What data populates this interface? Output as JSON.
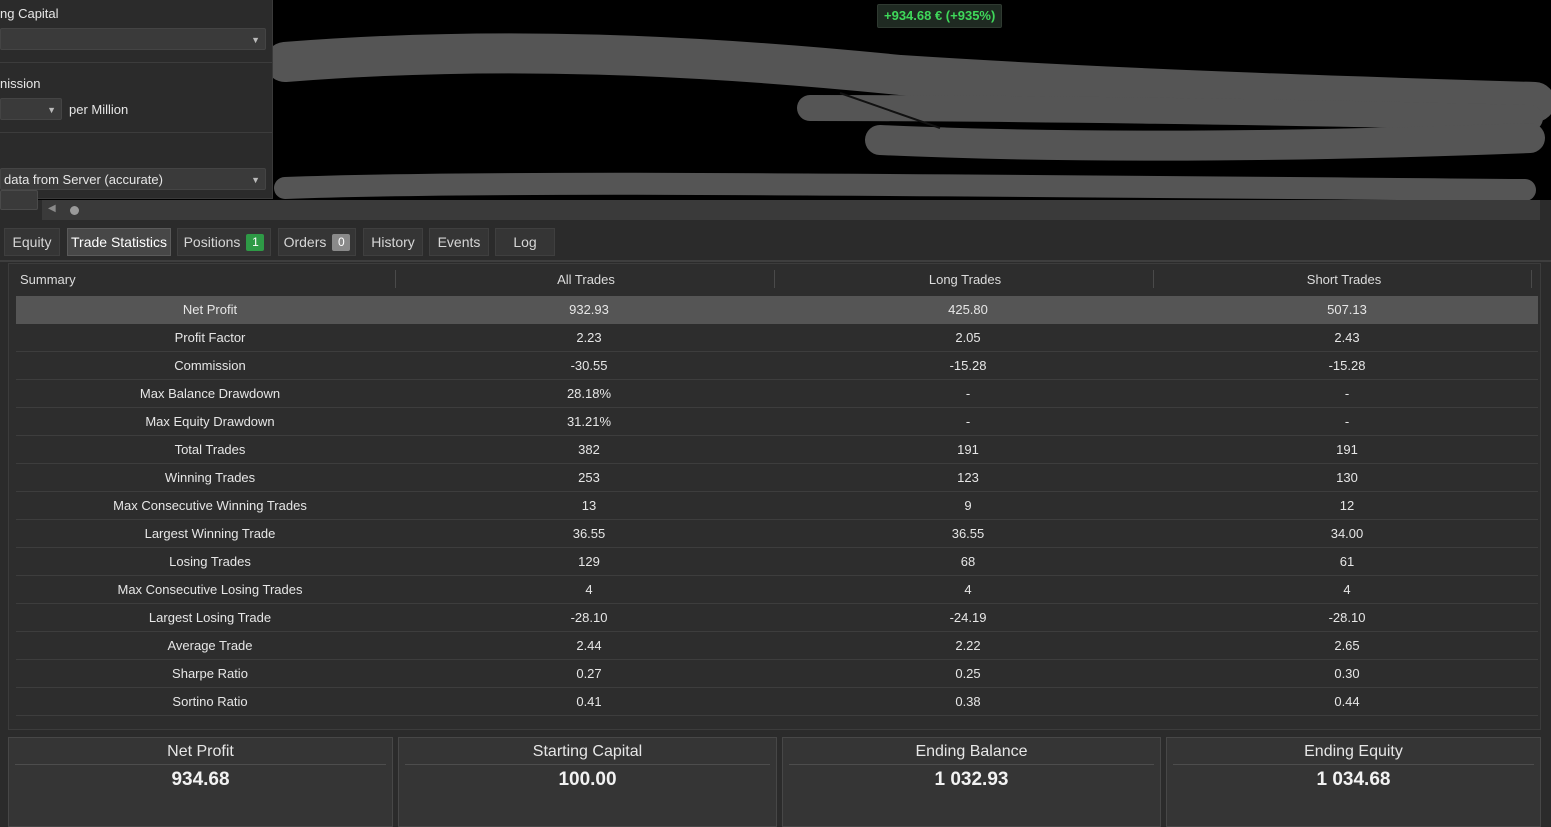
{
  "chart": {
    "profit_badge": "+934.68 € (+935%)"
  },
  "settings": {
    "capital_label": "ng Capital",
    "capital_value": "",
    "commission_label": "nission",
    "commission_value": "",
    "commission_unit": "per Million",
    "data_source_value": "data from Server (accurate)"
  },
  "tabs": [
    {
      "label": "Equity"
    },
    {
      "label": "Trade Statistics"
    },
    {
      "label": "Positions",
      "badge": "1"
    },
    {
      "label": "Orders",
      "badge": "0"
    },
    {
      "label": "History"
    },
    {
      "label": "Events"
    },
    {
      "label": "Log"
    }
  ],
  "stats": {
    "headers": [
      "Summary",
      "All Trades",
      "Long Trades",
      "Short Trades"
    ],
    "rows": [
      [
        "Net Profit",
        "932.93",
        "425.80",
        "507.13"
      ],
      [
        "Profit Factor",
        "2.23",
        "2.05",
        "2.43"
      ],
      [
        "Commission",
        "-30.55",
        "-15.28",
        "-15.28"
      ],
      [
        "Max Balance Drawdown",
        "28.18%",
        "-",
        "-"
      ],
      [
        "Max Equity Drawdown",
        "31.21%",
        "-",
        "-"
      ],
      [
        "Total Trades",
        "382",
        "191",
        "191"
      ],
      [
        "Winning Trades",
        "253",
        "123",
        "130"
      ],
      [
        "Max Consecutive Winning Trades",
        "13",
        "9",
        "12"
      ],
      [
        "Largest Winning Trade",
        "36.55",
        "36.55",
        "34.00"
      ],
      [
        "Losing Trades",
        "129",
        "68",
        "61"
      ],
      [
        "Max Consecutive Losing Trades",
        "4",
        "4",
        "4"
      ],
      [
        "Largest Losing Trade",
        "-28.10",
        "-24.19",
        "-28.10"
      ],
      [
        "Average Trade",
        "2.44",
        "2.22",
        "2.65"
      ],
      [
        "Sharpe Ratio",
        "0.27",
        "0.25",
        "0.30"
      ],
      [
        "Sortino Ratio",
        "0.41",
        "0.38",
        "0.44"
      ]
    ]
  },
  "cards": [
    {
      "title": "Net Profit",
      "value": "934.68"
    },
    {
      "title": "Starting Capital",
      "value": "100.00"
    },
    {
      "title": "Ending Balance",
      "value": "1 032.93"
    },
    {
      "title": "Ending Equity",
      "value": "1 034.68"
    }
  ],
  "colors": {
    "profit_green": "#3fd85a",
    "badge_green": "#2e9a46",
    "badge_grey": "#8a8a8a",
    "highlight_row": "#555555"
  },
  "icons": {
    "select_arrow": "dropdown-arrow-icon",
    "scroll_left": "scroll-left-arrow-icon"
  }
}
